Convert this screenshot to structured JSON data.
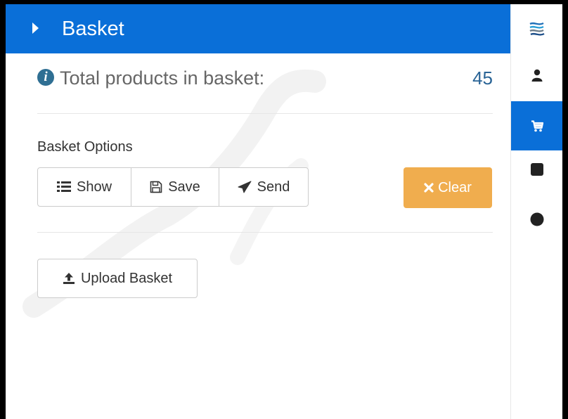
{
  "panel": {
    "header": {
      "title": "Basket"
    },
    "summary": {
      "label": "Total products in basket:",
      "count": "45"
    },
    "options": {
      "label": "Basket Options",
      "show_label": "Show",
      "save_label": "Save",
      "send_label": "Send",
      "clear_label": "Clear"
    },
    "upload_label": "Upload Basket"
  },
  "sidebar": {
    "items": [
      {
        "icon": "layers-logo-icon",
        "active": false
      },
      {
        "icon": "user-icon",
        "active": false
      },
      {
        "icon": "shopping-cart-icon",
        "active": true
      },
      {
        "icon": "square-icon",
        "active": false
      },
      {
        "icon": "circle-icon",
        "active": false
      }
    ]
  },
  "colors": {
    "header": "#0a6fd8",
    "sidebar_active": "#0a6fd8",
    "clear_button": "#f0ad4e",
    "count": "#2a6496",
    "info_icon": "#2f6f93"
  }
}
